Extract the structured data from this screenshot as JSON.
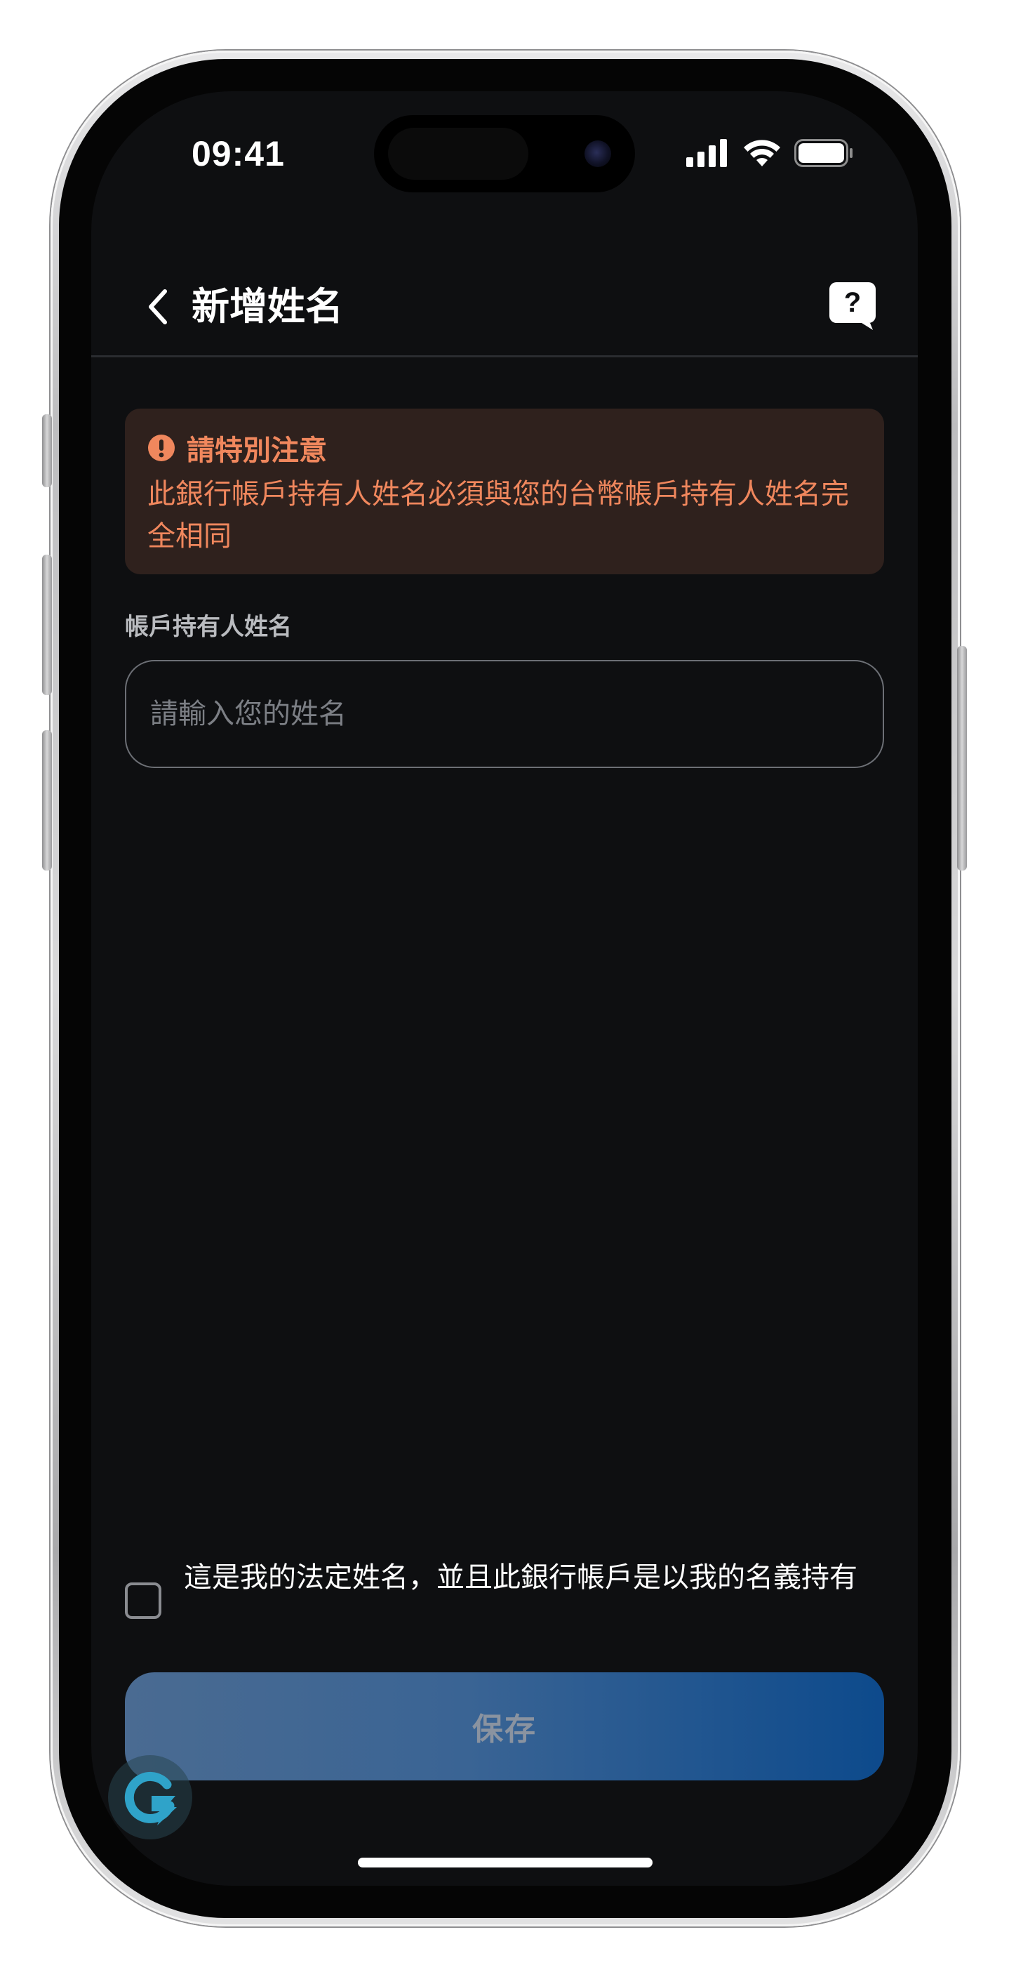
{
  "status_bar": {
    "time": "09:41"
  },
  "header": {
    "title": "新增姓名",
    "back_icon": "chevron-left-icon",
    "help_icon": "help-bubble-icon"
  },
  "warning": {
    "icon": "exclamation-circle-icon",
    "title": "請特別注意",
    "body": "此銀行帳戶持有人姓名必須與您的台幣帳戶持有人姓名完全相同"
  },
  "form": {
    "label": "帳戶持有人姓名",
    "placeholder": "請輸入您的姓名",
    "value": ""
  },
  "confirm": {
    "checked": false,
    "label": "這是我的法定姓名，並且此銀行帳戶是以我的名義持有"
  },
  "actions": {
    "save_label": "保存"
  },
  "colors": {
    "background": "#0e0f11",
    "warning_bg": "#2f211d",
    "warning_text": "#f0875d",
    "button_gradient_end": "#0d4a8c"
  }
}
